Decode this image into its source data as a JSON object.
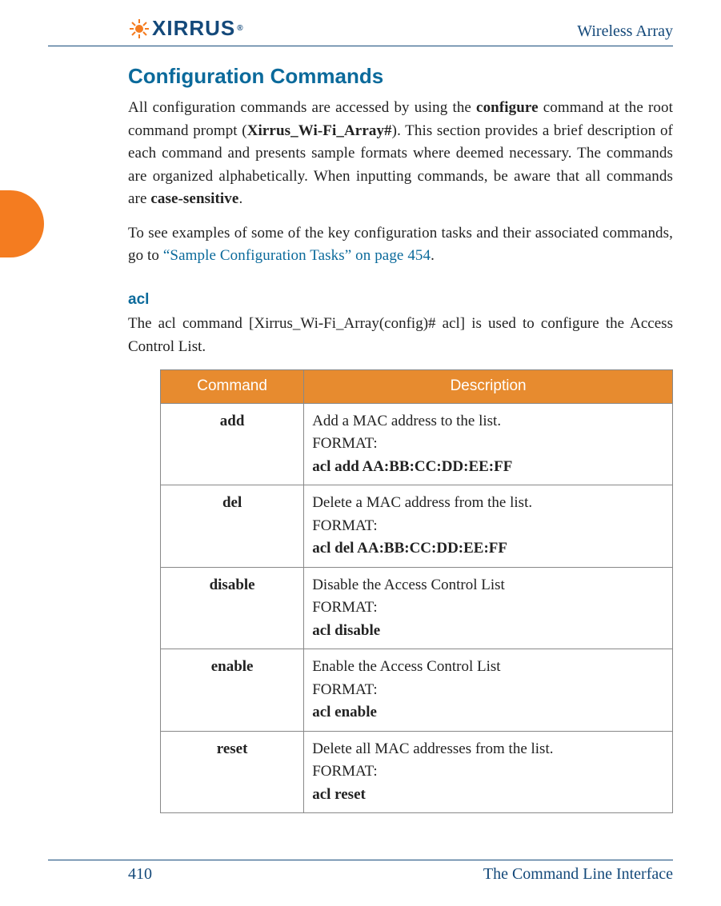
{
  "header": {
    "logo_text": "XIRRUS",
    "doc_title": "Wireless Array"
  },
  "section": {
    "title": "Configuration Commands",
    "intro_parts": {
      "p1a": "All configuration commands are accessed by using the ",
      "p1b_bold": "configure",
      "p1c": " command at the root command prompt (",
      "p1d_bold": "Xirrus_Wi-Fi_Array#",
      "p1e": "). This section provides a brief description of each command and presents sample formats where deemed necessary. The commands are organized alphabetically. When inputting commands, be aware that all commands are ",
      "p1f_bold": "case-sensitive",
      "p1g": "."
    },
    "intro2_parts": {
      "a": "To see examples of some of the key configuration tasks and their associated commands, go to ",
      "link": "“Sample Configuration Tasks” on page 454",
      "b": "."
    },
    "sub_heading": "acl",
    "acl_parts": {
      "a": "The ",
      "b_bold": "acl",
      "c": " command [",
      "d_bold": "Xirrus_Wi-Fi_Array(config)# acl",
      "e": "] is used to configure the Access Control List."
    }
  },
  "table": {
    "headers": {
      "col1": "Command",
      "col2": "Description"
    },
    "rows": [
      {
        "cmd": "add",
        "desc1": "Add a MAC address to the list.",
        "format_label": "FORMAT:",
        "format_value": "acl add AA:BB:CC:DD:EE:FF"
      },
      {
        "cmd": "del",
        "desc1": "Delete a MAC address from the list.",
        "format_label": "FORMAT:",
        "format_value": "acl del AA:BB:CC:DD:EE:FF"
      },
      {
        "cmd": "disable",
        "desc1": "Disable the Access Control List",
        "format_label": "FORMAT:",
        "format_value": "acl disable"
      },
      {
        "cmd": "enable",
        "desc1": "Enable the Access Control List",
        "format_label": "FORMAT:",
        "format_value": "acl enable"
      },
      {
        "cmd": "reset",
        "desc1": "Delete all MAC addresses from the list.",
        "format_label": "FORMAT:",
        "format_value": "acl reset"
      }
    ]
  },
  "footer": {
    "page_number": "410",
    "section_name": "The Command Line Interface"
  }
}
